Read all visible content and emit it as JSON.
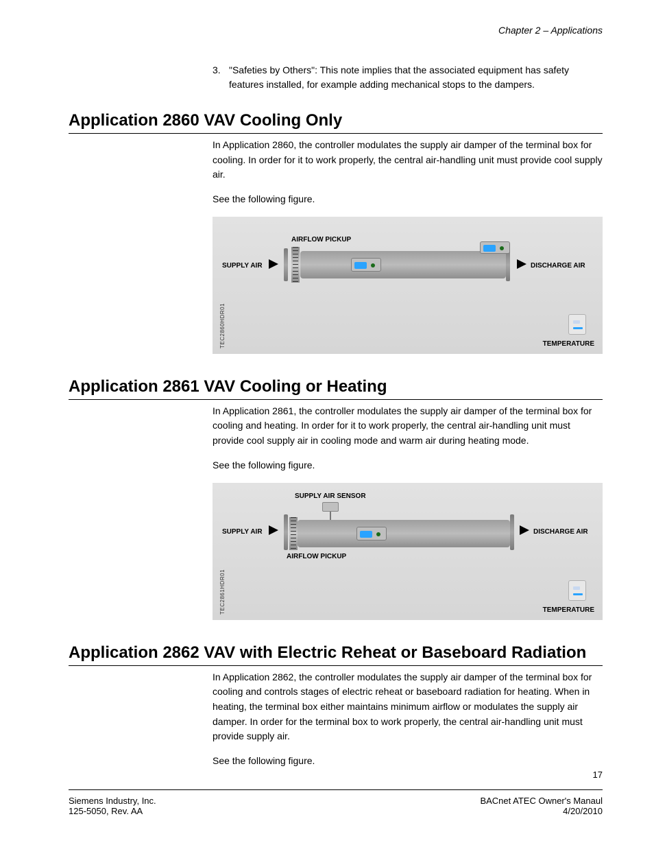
{
  "chapter_header": "Chapter 2 – Applications",
  "list3": {
    "num": "3.",
    "text": "\"Safeties by Others\": This note implies that the associated equipment has safety features installed, for example adding mechanical stops to the dampers."
  },
  "sec2860": {
    "heading": "Application 2860 VAV Cooling Only",
    "p1": "In Application 2860, the controller modulates the supply air damper of the terminal box for cooling. In order for it to work properly, the central air-handling unit must provide cool supply air.",
    "p2": "See the following figure."
  },
  "fig2860": {
    "airflow_pickup": "AIRFLOW PICKUP",
    "supply_air": "SUPPLY AIR",
    "discharge_air": "DISCHARGE AIR",
    "temperature": "TEMPERATURE",
    "code": "TEC2860HDR01"
  },
  "sec2861": {
    "heading": "Application 2861 VAV Cooling or Heating",
    "p1": "In Application 2861, the controller modulates the supply air damper of the terminal box for cooling and heating. In order for it to work properly, the central air-handling unit must provide cool supply air in cooling mode and warm air during heating mode.",
    "p2": "See the following figure."
  },
  "fig2861": {
    "supply_air_sensor": "SUPPLY AIR SENSOR",
    "supply_air": "SUPPLY AIR",
    "airflow_pickup": "AIRFLOW PICKUP",
    "discharge_air": "DISCHARGE AIR",
    "temperature": "TEMPERATURE",
    "code": "TEC2861HDR01"
  },
  "sec2862": {
    "heading": "Application 2862 VAV with Electric Reheat or Baseboard Radiation",
    "p1": "In Application 2862, the controller modulates the supply air damper of the terminal box for cooling and controls stages of electric reheat or baseboard radiation for heating. When in heating, the terminal box either maintains minimum airflow or modulates the supply air damper. In order for the terminal box to work properly, the central air-handling unit must provide supply air.",
    "p2": "See the following figure."
  },
  "page_number": "17",
  "footer": {
    "left1": "Siemens Industry, Inc.",
    "left2": "125-5050, Rev. AA",
    "right1": "BACnet ATEC Owner's Manaul",
    "right2": "4/20/2010"
  }
}
